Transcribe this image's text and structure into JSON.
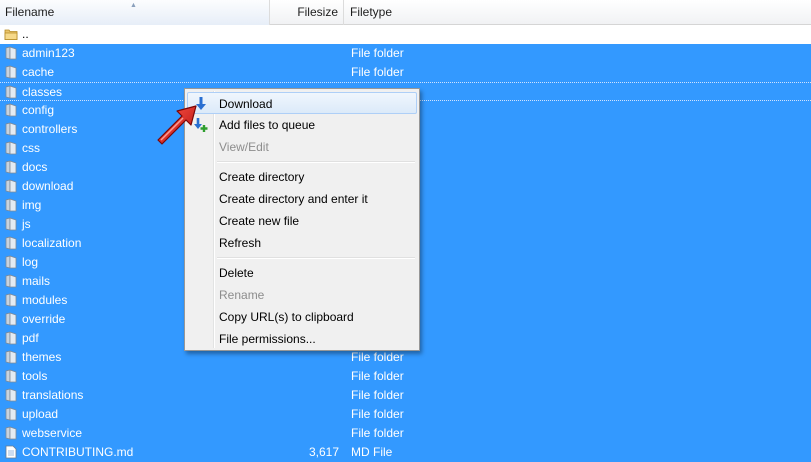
{
  "columns": {
    "filename": "Filename",
    "filesize": "Filesize",
    "filetype": "Filetype"
  },
  "rows": [
    {
      "name": "..",
      "size": "",
      "type": "",
      "selected": false,
      "icon": "folder-icon"
    },
    {
      "name": "admin123",
      "size": "",
      "type": "File folder",
      "selected": true,
      "icon": "folder-icon"
    },
    {
      "name": "cache",
      "size": "",
      "type": "File folder",
      "selected": true,
      "icon": "folder-icon"
    },
    {
      "name": "classes",
      "size": "",
      "type": "",
      "selected": true,
      "focused": true,
      "icon": "folder-icon"
    },
    {
      "name": "config",
      "size": "",
      "type": "",
      "selected": true,
      "icon": "folder-icon"
    },
    {
      "name": "controllers",
      "size": "",
      "type": "",
      "selected": true,
      "icon": "folder-icon"
    },
    {
      "name": "css",
      "size": "",
      "type": "",
      "selected": true,
      "icon": "folder-icon"
    },
    {
      "name": "docs",
      "size": "",
      "type": "",
      "selected": true,
      "icon": "folder-icon"
    },
    {
      "name": "download",
      "size": "",
      "type": "",
      "selected": true,
      "icon": "folder-icon"
    },
    {
      "name": "img",
      "size": "",
      "type": "",
      "selected": true,
      "icon": "folder-icon"
    },
    {
      "name": "js",
      "size": "",
      "type": "",
      "selected": true,
      "icon": "folder-icon"
    },
    {
      "name": "localization",
      "size": "",
      "type": "",
      "selected": true,
      "icon": "folder-icon"
    },
    {
      "name": "log",
      "size": "",
      "type": "",
      "selected": true,
      "icon": "folder-icon"
    },
    {
      "name": "mails",
      "size": "",
      "type": "",
      "selected": true,
      "icon": "folder-icon"
    },
    {
      "name": "modules",
      "size": "",
      "type": "",
      "selected": true,
      "icon": "folder-icon"
    },
    {
      "name": "override",
      "size": "",
      "type": "",
      "selected": true,
      "icon": "folder-icon"
    },
    {
      "name": "pdf",
      "size": "",
      "type": "",
      "selected": true,
      "icon": "folder-icon"
    },
    {
      "name": "themes",
      "size": "",
      "type": "File folder",
      "selected": true,
      "icon": "folder-icon"
    },
    {
      "name": "tools",
      "size": "",
      "type": "File folder",
      "selected": true,
      "icon": "folder-icon"
    },
    {
      "name": "translations",
      "size": "",
      "type": "File folder",
      "selected": true,
      "icon": "folder-icon"
    },
    {
      "name": "upload",
      "size": "",
      "type": "File folder",
      "selected": true,
      "icon": "folder-icon"
    },
    {
      "name": "webservice",
      "size": "",
      "type": "File folder",
      "selected": true,
      "icon": "folder-icon"
    },
    {
      "name": "CONTRIBUTING.md",
      "size": "3,617",
      "type": "MD File",
      "selected": true,
      "icon": "file-icon"
    }
  ],
  "context_menu": {
    "items": [
      {
        "label": "Download",
        "highlighted": true,
        "disabled": false,
        "icon": "download-arrow-icon"
      },
      {
        "label": "Add files to queue",
        "highlighted": false,
        "disabled": false,
        "icon": "add-to-queue-icon"
      },
      {
        "label": "View/Edit",
        "highlighted": false,
        "disabled": true
      },
      {
        "separator": true
      },
      {
        "label": "Create directory",
        "highlighted": false,
        "disabled": false
      },
      {
        "label": "Create directory and enter it",
        "highlighted": false,
        "disabled": false
      },
      {
        "label": "Create new file",
        "highlighted": false,
        "disabled": false
      },
      {
        "label": "Refresh",
        "highlighted": false,
        "disabled": false
      },
      {
        "separator": true
      },
      {
        "label": "Delete",
        "highlighted": false,
        "disabled": false
      },
      {
        "label": "Rename",
        "highlighted": false,
        "disabled": true
      },
      {
        "label": "Copy URL(s) to clipboard",
        "highlighted": false,
        "disabled": false
      },
      {
        "label": "File permissions...",
        "highlighted": false,
        "disabled": false
      }
    ]
  },
  "colors": {
    "selection": "#3399ff",
    "menu_bg": "#f0f0f0",
    "disabled_text": "#8d8d8d",
    "annotation_arrow": "#e0201b"
  }
}
